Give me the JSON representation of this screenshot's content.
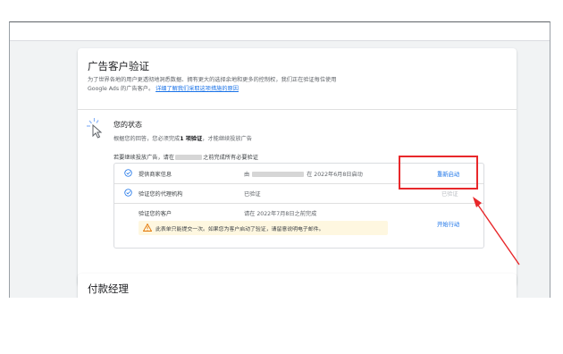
{
  "verification": {
    "title": "广告客户验证",
    "description": "为了世界各地的用户更透彻地洞悉数据、拥有更大的选择余地和更多的控制权，我们正在验证每位使用 Google Ads 的广告客户。",
    "learn_more": "详细了解我们采取这项措施的原因",
    "status_title": "您的状态",
    "status_desc_pre": "根据您的回答，您必须完成",
    "status_desc_bold": "1 项验证",
    "status_desc_post": "，才能继续投放广告",
    "deadline_pre": "若要继续投放广告，请在",
    "deadline_post": "之前完成所有必要验证",
    "tasks": [
      {
        "name": "提供商家信息",
        "status_pre": "由",
        "status_post": "在 2022年6月8日启动",
        "action": "重新启动"
      },
      {
        "name": "验证您的代理机构",
        "status": "已验证",
        "action": "已验证"
      },
      {
        "name": "验证您的客户",
        "status": "请在 2022年7月8日之前完成",
        "action": "开始行动",
        "warning": "此表单只能提交一次。如果您为客户启动了验证，请留意说明电子邮件。"
      }
    ]
  },
  "payments": {
    "title": "付款经理"
  },
  "colors": {
    "accent": "#1a73e8",
    "annotation": "#e8282b",
    "warning_bg": "#fef7e0"
  },
  "icons": {
    "status": "cursor-sparkle-icon",
    "task_done": "check-circle-icon",
    "warning": "warning-triangle-icon"
  }
}
